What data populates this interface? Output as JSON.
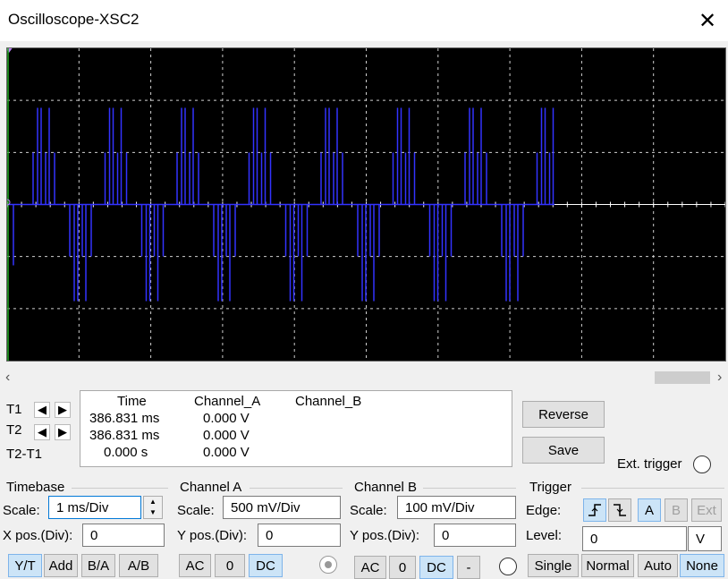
{
  "window": {
    "title": "Oscilloscope-XSC2",
    "close_icon": "✕"
  },
  "scroll": {
    "left": "‹",
    "right": "›"
  },
  "cursors": {
    "t1": "T1",
    "t2": "T2",
    "t2t1": "T2-T1",
    "left_arrow": "🠔",
    "right_arrow": "🠖"
  },
  "readout": {
    "headers": [
      "Time",
      "Channel_A",
      "Channel_B"
    ],
    "rows": [
      {
        "time": "386.831 ms",
        "a": "0.000 V",
        "b": ""
      },
      {
        "time": "386.831 ms",
        "a": "0.000 V",
        "b": ""
      },
      {
        "time": "0.000 s",
        "a": "0.000 V",
        "b": ""
      }
    ]
  },
  "buttons": {
    "reverse": "Reverse",
    "save": "Save",
    "ext_trigger": "Ext. trigger"
  },
  "timebase": {
    "title": "Timebase",
    "scale_label": "Scale:",
    "scale_value": "1 ms/Div",
    "xpos_label": "X pos.(Div):",
    "xpos_value": "0",
    "modes": [
      "Y/T",
      "Add",
      "B/A",
      "A/B"
    ]
  },
  "channel_a": {
    "title": "Channel A",
    "scale_label": "Scale:",
    "scale_value": "500 mV/Div",
    "ypos_label": "Y pos.(Div):",
    "ypos_value": "0",
    "coupling": [
      "AC",
      "0",
      "DC"
    ]
  },
  "channel_b": {
    "title": "Channel B",
    "scale_label": "Scale:",
    "scale_value": "100 mV/Div",
    "ypos_label": "Y pos.(Div):",
    "ypos_value": "0",
    "coupling": [
      "AC",
      "0",
      "DC",
      "-"
    ]
  },
  "trigger": {
    "title": "Trigger",
    "edge_label": "Edge:",
    "level_label": "Level:",
    "level_value": "0",
    "level_unit": "V",
    "sources": [
      "A",
      "B",
      "Ext"
    ],
    "modes": [
      "Single",
      "Normal",
      "Auto",
      "None"
    ]
  },
  "colors": {
    "trace": "#3333ff",
    "screen_bg": "#000000",
    "grid": "#cfcfcf",
    "active": "#cce4f7"
  }
}
